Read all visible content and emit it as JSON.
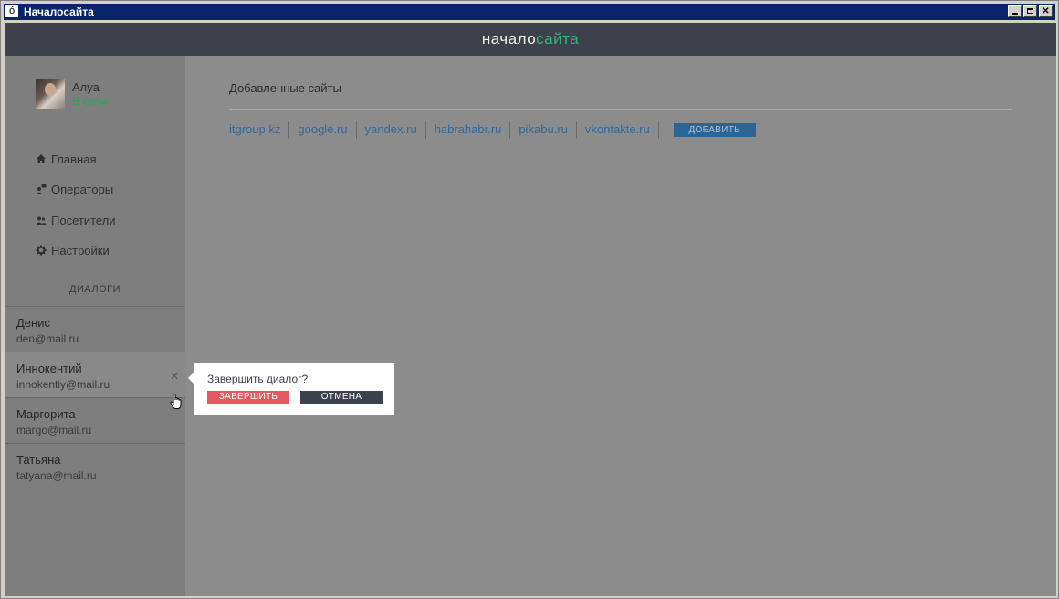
{
  "window": {
    "title": "Началосайта",
    "icon": "app-logo-icon"
  },
  "logo": {
    "part1": "начало",
    "part2": "сайта",
    "color1": "#f0f0f0",
    "color2": "#36b37e"
  },
  "user": {
    "name": "Алуа",
    "status": "В сети",
    "status_color": "#27a85a"
  },
  "nav": [
    {
      "label": "Главная",
      "icon": "home-icon"
    },
    {
      "label": "Операторы",
      "icon": "operators-icon"
    },
    {
      "label": "Посетители",
      "icon": "visitors-icon"
    },
    {
      "label": "Настройки",
      "icon": "gear-icon"
    }
  ],
  "dialogs": {
    "title": "ДИАЛОГИ",
    "items": [
      {
        "name": "Денис",
        "email": "den@mail.ru"
      },
      {
        "name": "Иннокентий",
        "email": "innokentiy@mail.ru"
      },
      {
        "name": "Маргорита",
        "email": "margo@mail.ru"
      },
      {
        "name": "Татьяна",
        "email": "tatyana@mail.ru"
      }
    ]
  },
  "main": {
    "section_title": "Добавленные сайты",
    "sites": [
      "itgroup.kz",
      "google.ru",
      "yandex.ru",
      "habrahabr.ru",
      "pikabu.ru",
      "vkontakte.ru"
    ],
    "add_label": "ДОБАВИТЬ"
  },
  "popup": {
    "question": "Завершить диалог?",
    "confirm_label": "ЗАВЕРШИТЬ",
    "cancel_label": "ОТМЕНА",
    "confirm_color": "#e4585f",
    "cancel_color": "#3e404c"
  }
}
